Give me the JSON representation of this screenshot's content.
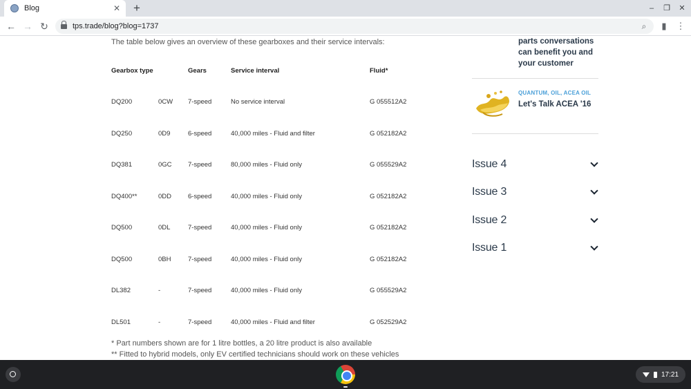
{
  "browser": {
    "tab_title": "Blog",
    "tab_close": "✕",
    "new_tab": "+",
    "url": "tps.trade/blog?blog=1737",
    "window_controls": [
      "–",
      "❐",
      "✕"
    ]
  },
  "article": {
    "intro": "The table below gives an overview of these gearboxes and their service intervals:",
    "table": {
      "headers": [
        "Gearbox type",
        "",
        "Gears",
        "Service interval",
        "Fluid*"
      ],
      "rows": [
        [
          "DQ200",
          "0CW",
          "7-speed",
          "No service interval",
          "G 055512A2"
        ],
        [
          "DQ250",
          "0D9",
          "6-speed",
          "40,000 miles - Fluid and filter",
          "G 052182A2"
        ],
        [
          "DQ381",
          "0GC",
          "7-speed",
          "80,000 miles - Fluid only",
          "G 055529A2"
        ],
        [
          "DQ400**",
          "0DD",
          "6-speed",
          "40,000 miles - Fluid only",
          "G 052182A2"
        ],
        [
          "DQ500",
          "0DL",
          "7-speed",
          "40,000 miles - Fluid only",
          "G 052182A2"
        ],
        [
          "DQ500",
          "0BH",
          "7-speed",
          "40,000 miles - Fluid only",
          "G 052182A2"
        ],
        [
          "DL382",
          "-",
          "7-speed",
          "40,000 miles - Fluid only",
          "G 055529A2"
        ],
        [
          "DL501",
          "-",
          "7-speed",
          "40,000 miles - Fluid and filter",
          "G 052529A2"
        ]
      ]
    },
    "footnote1": "* Part numbers shown are for 1 litre bottles, a 20 litre product is also available",
    "footnote2": "** Fitted to hybrid models, only EV certified technicians should work on these vehicles"
  },
  "sidebar": {
    "prev_card_lines": [
      "parts conversations",
      "can benefit you and",
      "your customer"
    ],
    "card": {
      "tags": "QUANTUM, OIL, ACEA OIL",
      "title": "Let's Talk ACEA '16"
    },
    "issues": [
      "Issue 4",
      "Issue 3",
      "Issue 2",
      "Issue 1"
    ]
  },
  "shelf": {
    "time": "17:21"
  }
}
